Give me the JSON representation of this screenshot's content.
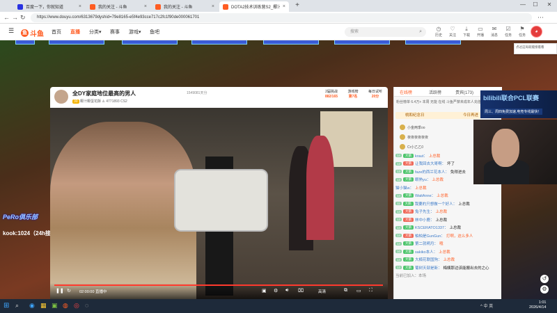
{
  "browser": {
    "tabs": [
      {
        "label": "百度一下，你就知道",
        "favicon_color": "#2932e1",
        "active": false
      },
      {
        "label": "我的关注 - 斗鱼",
        "favicon_color": "#ff5d23",
        "active": false
      },
      {
        "label": "我的关注 - 斗鱼",
        "favicon_color": "#ff5d23",
        "active": false
      },
      {
        "label": "DOTA2技术训练营S2_椰汁帧...",
        "favicon_color": "#ff5d23",
        "active": true
      }
    ],
    "new_tab": "+",
    "url": "https://www.douyu.com/6313679dyshid=79e8165-e5f4e93cce717c2fc1f90de000061701"
  },
  "site": {
    "logo": "斗鱼",
    "nav": [
      {
        "label": "首页",
        "active": false
      },
      {
        "label": "直播",
        "active": true
      },
      {
        "label": "分类",
        "active": false
      },
      {
        "label": "赛事",
        "active": false
      },
      {
        "label": "游戏",
        "active": false
      },
      {
        "label": "鱼吧",
        "active": false
      }
    ],
    "search_placeholder": "搜索",
    "header_icons": [
      {
        "label": "历史",
        "icon": "history-icon",
        "glyph": "◷"
      },
      {
        "label": "关注",
        "icon": "heart-icon",
        "glyph": "♡"
      },
      {
        "label": "下载",
        "icon": "download-icon",
        "glyph": "⤓"
      },
      {
        "label": "开播",
        "icon": "broadcast-icon",
        "glyph": "▭"
      },
      {
        "label": "消息",
        "icon": "message-icon",
        "glyph": "✉"
      },
      {
        "label": "任务",
        "icon": "task-icon",
        "glyph": "☑"
      },
      {
        "label": "任务",
        "icon": "gift-icon",
        "glyph": "⚑"
      }
    ],
    "tooltip": "点过这局就能接着看"
  },
  "room": {
    "title": "全DY家庭地位最高的男人",
    "room_id": "1549081天分",
    "level": "30",
    "category": "椰汁椰蛋花酥",
    "followers": "4771893",
    "fans_badge": "CS2",
    "stats": [
      {
        "label": "2届挑战",
        "value": "882/165"
      },
      {
        "label": "游戏榜",
        "value": "第7名"
      },
      {
        "label": "每日试听",
        "value": "20分"
      }
    ]
  },
  "video": {
    "time": "02:00:00",
    "live_label": "直播中",
    "quality": "高清"
  },
  "left_overlay": {
    "logo": "PeRo俱乐部",
    "text": "kook:1024（24h接待）"
  },
  "chat": {
    "tabs": [
      {
        "label": "在线榜",
        "active": true
      },
      {
        "label": "活跃榜",
        "active": false
      },
      {
        "label": "贵宾(173)",
        "active": false
      }
    ],
    "rank_line": "粉丝榜单  6.4万+ 本周  无能  在线  斗鱼严禁未成年人充值打赏",
    "festival": "桃和纪念日",
    "festival_right": "今日再进",
    "rank_items": [
      {
        "name": "小金两季oo"
      },
      {
        "name": "夜夜夜夜夜夜"
      },
      {
        "name": "Cr小乙乙0"
      }
    ],
    "messages": [
      {
        "badge": "14",
        "fan": "大鹅",
        "name": "kraut：",
        "text": "上总裁",
        "hl": true,
        "red": false
      },
      {
        "badge": "12",
        "fan": "大鹅",
        "name": "让我回去大哥啊：",
        "text": "坏了",
        "hl": false,
        "red": true
      },
      {
        "badge": "13",
        "fan": "大鹅",
        "name": "faze的西兰花本人：",
        "text": "免得进去",
        "hl": false,
        "red": false
      },
      {
        "badge": "13",
        "fan": "大鹅",
        "name": "眼熟yu：",
        "text": "上总裁",
        "hl": true,
        "red": false
      },
      {
        "badge": "",
        "fan": "",
        "name": "猫小猫w：",
        "text": "上总裁",
        "hl": true,
        "red": false
      },
      {
        "badge": "14",
        "fan": "大鹅",
        "name": "WaitAnne：",
        "text": "上总裁",
        "hl": true,
        "red": false
      },
      {
        "badge": "11",
        "fan": "大鹅",
        "name": "我要的只想做一个好人：",
        "text": "上总裁",
        "hl": false,
        "red": false
      },
      {
        "badge": "14",
        "fan": "大鹅",
        "name": "兔子先生：",
        "text": "上总裁",
        "hl": true,
        "red": true
      },
      {
        "badge": "13",
        "fan": "大鹅",
        "name": "林中小鹿：",
        "text": "上总裁",
        "hl": false,
        "red": true
      },
      {
        "badge": "14",
        "fan": "大鹅",
        "name": "KSCERATO1337：",
        "text": "上总裁",
        "hl": false,
        "red": false
      },
      {
        "badge": "14",
        "fan": "大鹅",
        "name": "柏柏是GunGun：",
        "text": "打啊，这么多人",
        "hl": true,
        "red": true
      },
      {
        "badge": "14",
        "fan": "大鹅",
        "name": "第二就明月：",
        "text": "哦",
        "hl": true,
        "red": false
      },
      {
        "badge": "10",
        "fan": "大鹅",
        "name": "sakiko本人：",
        "text": "上总裁",
        "hl": true,
        "red": false
      },
      {
        "badge": "14",
        "fan": "大鹅",
        "name": "大楠花联国狗：",
        "text": "上总裁",
        "hl": true,
        "red": false
      },
      {
        "badge": "13",
        "fan": "大鹅",
        "name": "葡树天部是新：",
        "text": "梅姨那边该能搬出去的之心",
        "hl": false,
        "red": false
      }
    ],
    "bottom_hint": "当前已加入：本场"
  },
  "ad": {
    "title": "bilibili联合PCL联赛",
    "subtitle": "周三、周四免费加速,电竞专线最快！"
  },
  "taskbar": {
    "time": "1:01",
    "date": "2026/4/14",
    "tray": "^ 中 英"
  }
}
